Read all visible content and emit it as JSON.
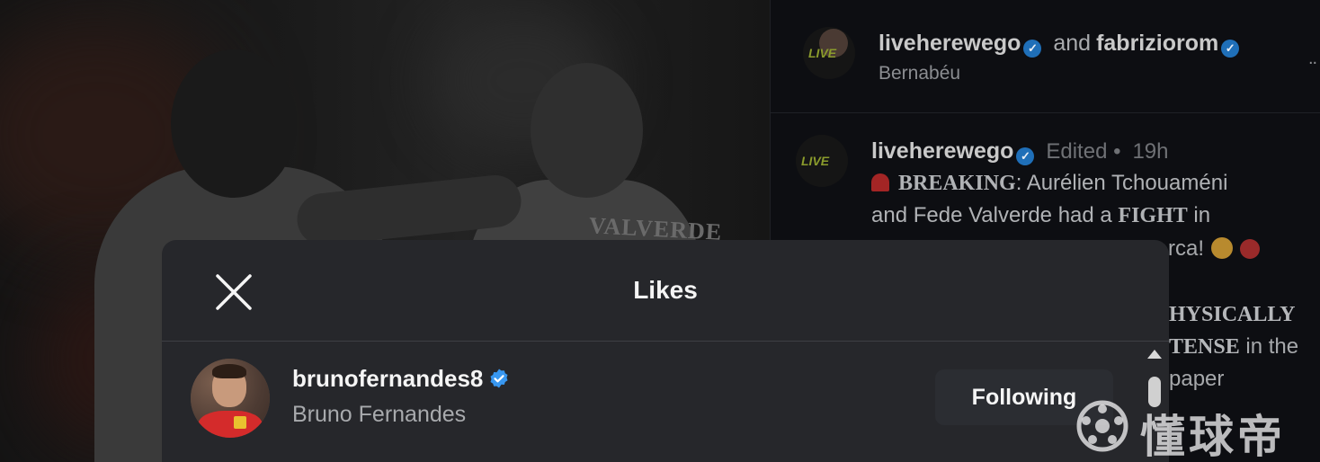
{
  "background": {
    "post_image": {
      "jersey_text": "VALVERDE"
    },
    "comments": [
      {
        "username": "liveherewego",
        "connector": "and",
        "coauthor": "fabriziorom",
        "subtitle": "Bernabéu",
        "more_label": "..",
        "avatar_text": "LIVE"
      },
      {
        "username": "liveherewego",
        "edited": "Edited •",
        "time": "19h",
        "avatar_text": "LIVE",
        "line1_bold": "BREAKING",
        "line1_rest": ": Aurélien Tchouaméni",
        "line2_a": "and Fede Valverde had a ",
        "line2_bold": "FIGHT",
        "line2_b": " in",
        "line3_tail": "rca!",
        "line4_bold": "HYSICALLY",
        "line5_bold": "TENSE",
        "line5_rest": " in the",
        "line6_tail": "paper"
      }
    ]
  },
  "modal": {
    "title": "Likes",
    "close_label": "Close",
    "users": [
      {
        "username": "brunofernandes8",
        "full_name": "Bruno Fernandes",
        "verified": true,
        "button_label": "Following"
      }
    ]
  },
  "watermark": {
    "text": "懂球帝"
  },
  "colors": {
    "verified_blue": "#3897f0",
    "modal_bg": "#26272b",
    "button_bg": "#2b2d32"
  }
}
